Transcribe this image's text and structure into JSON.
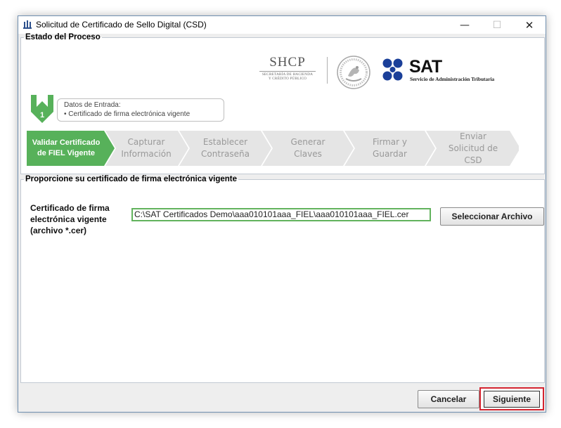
{
  "window": {
    "title": "Solicitud de Certificado de Sello Digital (CSD)",
    "icon": "java-app-icon",
    "controls": {
      "minimize": "—",
      "maximize": "☐",
      "close": "✕"
    }
  },
  "process_panel": {
    "legend": "Estado del Proceso",
    "logos": {
      "shcp": {
        "word": "SHCP",
        "sub_line1": "SECRETARÍA DE HACIENDA",
        "sub_line2": "Y CRÉDITO PÚBLICO"
      },
      "seal": "mexico-coat-of-arms-seal",
      "sat": {
        "word": "SAT",
        "sub": "Servicio de Administración Tributaria",
        "color": "#1a3f99"
      }
    },
    "current_step": {
      "number": "1",
      "title": "Datos de Entrada:",
      "item": "•   Certificado de firma electrónica vigente"
    },
    "steps": [
      {
        "label_lines": [
          "Validar Certificado",
          "de FIEL Vigente"
        ],
        "active": true
      },
      {
        "label_lines": [
          "Capturar",
          "Información"
        ],
        "active": false
      },
      {
        "label_lines": [
          "Establecer",
          "Contraseña"
        ],
        "active": false
      },
      {
        "label_lines": [
          "Generar",
          "Claves"
        ],
        "active": false
      },
      {
        "label_lines": [
          "Firmar y",
          "Guardar"
        ],
        "active": false
      },
      {
        "label_lines": [
          "Enviar",
          "Solicitud de",
          "CSD"
        ],
        "active": false
      }
    ],
    "colors": {
      "active_step": "#57b15a",
      "inactive_step": "#e5e5e5"
    }
  },
  "certificate_panel": {
    "legend": "Proporcione su certificado de firma electrónica vigente",
    "field_label_lines": [
      "Certificado de firma",
      "electrónica vigente",
      "(archivo *.cer)"
    ],
    "path_value": "C:\\SAT Certificados Demo\\aaa010101aaa_FIEL\\aaa010101aaa_FIEL.cer",
    "select_button": "Seleccionar Archivo",
    "input_border_color": "#62b35d"
  },
  "footer": {
    "cancel_button": "Cancelar",
    "next_button": "Siguiente",
    "highlight_color": "#d42430"
  }
}
